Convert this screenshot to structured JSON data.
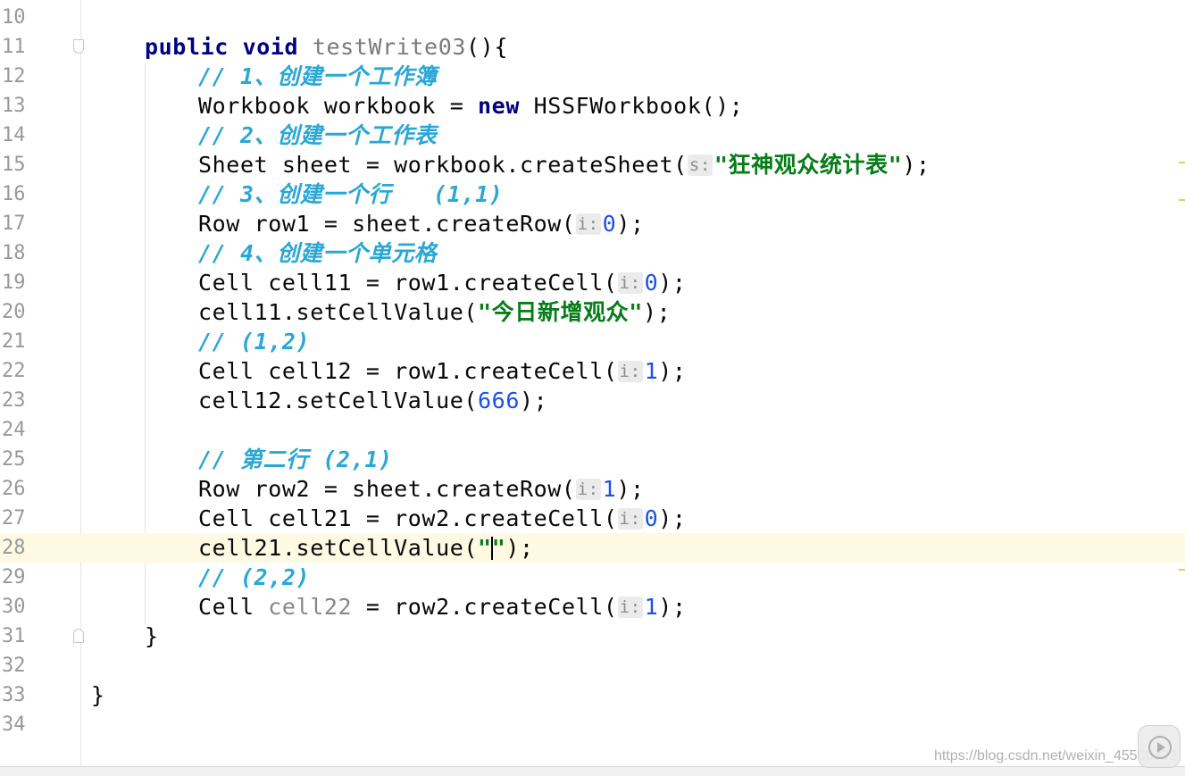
{
  "lines": [
    {
      "n": "10"
    },
    {
      "n": "11",
      "parts": [
        [
          "kw",
          "public"
        ],
        [
          "plain",
          " "
        ],
        [
          "kw",
          "void"
        ],
        [
          "plain",
          " "
        ],
        [
          "method",
          "testWrite03"
        ],
        [
          "plain",
          "(){"
        ]
      ]
    },
    {
      "n": "12",
      "parts": [
        [
          "cm",
          "// 1、创建一个工作簿"
        ]
      ]
    },
    {
      "n": "13",
      "parts": [
        [
          "plain",
          "Workbook workbook = "
        ],
        [
          "kw",
          "new"
        ],
        [
          "plain",
          " HSSFWorkbook();"
        ]
      ]
    },
    {
      "n": "14",
      "parts": [
        [
          "cm",
          "// 2、创建一个工作表"
        ]
      ]
    },
    {
      "n": "15",
      "parts": [
        [
          "plain",
          "Sheet sheet = workbook.createSheet("
        ],
        [
          "hint",
          "s:"
        ],
        [
          "str",
          "\"狂神观众统计表\""
        ],
        [
          "plain",
          ");"
        ]
      ]
    },
    {
      "n": "16",
      "parts": [
        [
          "cm",
          "// 3、创建一个行   (1,1)"
        ]
      ]
    },
    {
      "n": "17",
      "parts": [
        [
          "plain",
          "Row row1 = sheet.createRow("
        ],
        [
          "hint",
          "i:"
        ],
        [
          "num",
          "0"
        ],
        [
          "plain",
          ");"
        ]
      ]
    },
    {
      "n": "18",
      "parts": [
        [
          "cm",
          "// 4、创建一个单元格"
        ]
      ]
    },
    {
      "n": "19",
      "parts": [
        [
          "plain",
          "Cell cell11 = row1.createCell("
        ],
        [
          "hint",
          "i:"
        ],
        [
          "num",
          "0"
        ],
        [
          "plain",
          ");"
        ]
      ]
    },
    {
      "n": "20",
      "parts": [
        [
          "plain",
          "cell11.setCellValue("
        ],
        [
          "str",
          "\"今日新增观众\""
        ],
        [
          "plain",
          ");"
        ]
      ]
    },
    {
      "n": "21",
      "parts": [
        [
          "cm",
          "// (1,2)"
        ]
      ]
    },
    {
      "n": "22",
      "parts": [
        [
          "plain",
          "Cell cell12 = row1.createCell("
        ],
        [
          "hint",
          "i:"
        ],
        [
          "num",
          "1"
        ],
        [
          "plain",
          ");"
        ]
      ]
    },
    {
      "n": "23",
      "parts": [
        [
          "plain",
          "cell12.setCellValue("
        ],
        [
          "num",
          "666"
        ],
        [
          "plain",
          ");"
        ]
      ]
    },
    {
      "n": "24"
    },
    {
      "n": "25",
      "parts": [
        [
          "cm",
          "// 第二行 (2,1)"
        ]
      ]
    },
    {
      "n": "26",
      "parts": [
        [
          "plain",
          "Row row2 = sheet.createRow("
        ],
        [
          "hint",
          "i:"
        ],
        [
          "num",
          "1"
        ],
        [
          "plain",
          ");"
        ]
      ]
    },
    {
      "n": "27",
      "parts": [
        [
          "plain",
          "Cell cell21 = row2.createCell("
        ],
        [
          "hint",
          "i:"
        ],
        [
          "num",
          "0"
        ],
        [
          "plain",
          ");"
        ]
      ]
    },
    {
      "n": "28",
      "current": true,
      "parts": [
        [
          "plain",
          "cell21.setCellValue("
        ],
        [
          "str",
          "\""
        ],
        [
          "caret",
          ""
        ],
        [
          "str",
          "\""
        ],
        [
          "plain",
          ");"
        ]
      ]
    },
    {
      "n": "29",
      "parts": [
        [
          "cm",
          "// (2,2)"
        ]
      ]
    },
    {
      "n": "30",
      "parts": [
        [
          "plain",
          "Cell "
        ],
        [
          "unused",
          "cell22"
        ],
        [
          "plain",
          " = row2.createCell("
        ],
        [
          "hint",
          "i:"
        ],
        [
          "num",
          "1"
        ],
        [
          "plain",
          ");"
        ]
      ]
    },
    {
      "n": "31",
      "parts": [
        [
          "plain",
          "}"
        ]
      ]
    },
    {
      "n": "32"
    },
    {
      "n": "33",
      "parts": [
        [
          "plain",
          "}"
        ]
      ]
    },
    {
      "n": "34"
    }
  ],
  "watermark": "https://blog.csdn.net/weixin_45566322",
  "colors": {
    "keyword": "#000080",
    "comment": "#29a7d6",
    "string": "#067d17",
    "number": "#1750eb",
    "current_line": "#fdf9e3"
  },
  "icons": [
    "fold-marker-icon",
    "play-icon"
  ]
}
